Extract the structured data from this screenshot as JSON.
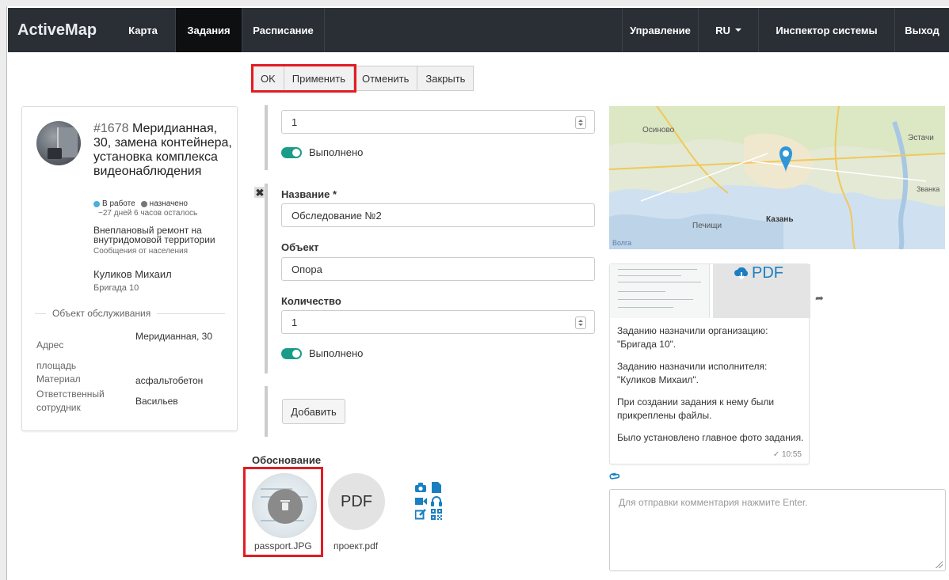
{
  "navbar": {
    "brand": "ActiveMap",
    "items": [
      {
        "label": "Карта"
      },
      {
        "label": "Задания"
      },
      {
        "label": "Расписание"
      },
      {
        "label": "Управление"
      },
      {
        "label": "RU"
      },
      {
        "label": "Инспектор системы"
      },
      {
        "label": "Выход"
      }
    ]
  },
  "toolbar": {
    "ok": "OK",
    "apply": "Применить",
    "cancel": "Отменить",
    "close": "Закрыть"
  },
  "task": {
    "number": "#1678",
    "title": "Меридианная, 30, замена контейнера, установка комплекса видеонаблюдения",
    "status_work": "В работе",
    "status_assigned": "назначено",
    "time_left": "~27 дней 6 часов осталось",
    "category": "Внеплановый ремонт на внутридомовой территории",
    "source": "Сообщения от населения",
    "assignee": "Куликов Михаил",
    "team": "Бригада 10"
  },
  "object_section": {
    "title": "Объект обслуживания",
    "fields": [
      {
        "key": "Адрес",
        "value": "Меридианная, 30"
      },
      {
        "key": "площадь",
        "value": ""
      },
      {
        "key": "Материал",
        "value": "асфальтобетон"
      },
      {
        "key": "Ответственный сотрудник",
        "value": "Васильев"
      }
    ]
  },
  "form": {
    "top_quantity": "1",
    "done_label": "Выполнено",
    "name_label": "Название *",
    "name_value": "Обследование №2",
    "object_label": "Объект",
    "object_value": "Опора",
    "qty_label": "Количество",
    "qty_value": "1",
    "done_label2": "Выполнено",
    "add_button": "Добавить"
  },
  "attachments": {
    "section_label": "Обоснование",
    "pdf_label": "PDF",
    "files": [
      "passport.JPG",
      "проект.pdf"
    ]
  },
  "map": {
    "labels": [
      "Осиново",
      "Эстачи",
      "Казань",
      "Печищи",
      "Званка",
      "Волга"
    ]
  },
  "feed": {
    "pdf_label": "PDF",
    "messages": [
      "Заданию назначили организацию: \"Бригада 10\".",
      "Заданию назначили исполнителя: \"Куликов Михаил\".",
      "При создании задания к нему были прикреплены файлы.",
      "Было установлено главное фото задания."
    ],
    "time": "✓ 10:55"
  },
  "comment": {
    "placeholder": "Для отправки комментария нажмите Enter."
  },
  "colors": {
    "navbar": "#2a2f35",
    "active_tab": "#0d0f11",
    "accent": "#1a7fc1",
    "toggle": "#1a9c88",
    "highlight": "#e21c23"
  }
}
